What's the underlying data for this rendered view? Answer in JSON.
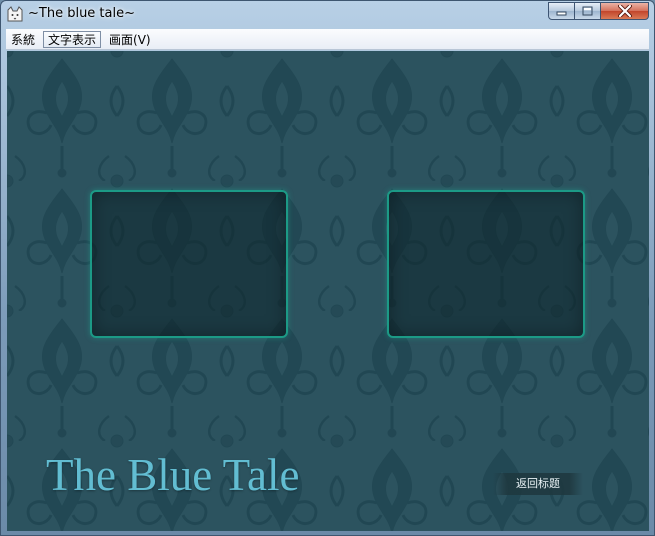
{
  "window": {
    "title": "~The blue tale~",
    "app_icon": "cat-icon",
    "controls": {
      "minimize_icon": "minimize-icon",
      "maximize_icon": "maximize-icon",
      "close_icon": "close-icon"
    }
  },
  "menubar": {
    "items": [
      {
        "label": "系統"
      },
      {
        "label": "文字表示",
        "selected": true
      },
      {
        "label": "画面(V)"
      }
    ]
  },
  "game": {
    "title": "The Blue Tale",
    "return_button_label": "返回标题",
    "colors": {
      "background": "#2c535f",
      "pattern": "#1f4450",
      "slot_border": "#1c9a86",
      "title_text": "#62bdd2"
    },
    "slots": [
      {
        "name": "left",
        "empty": true
      },
      {
        "name": "right",
        "empty": true
      }
    ]
  }
}
